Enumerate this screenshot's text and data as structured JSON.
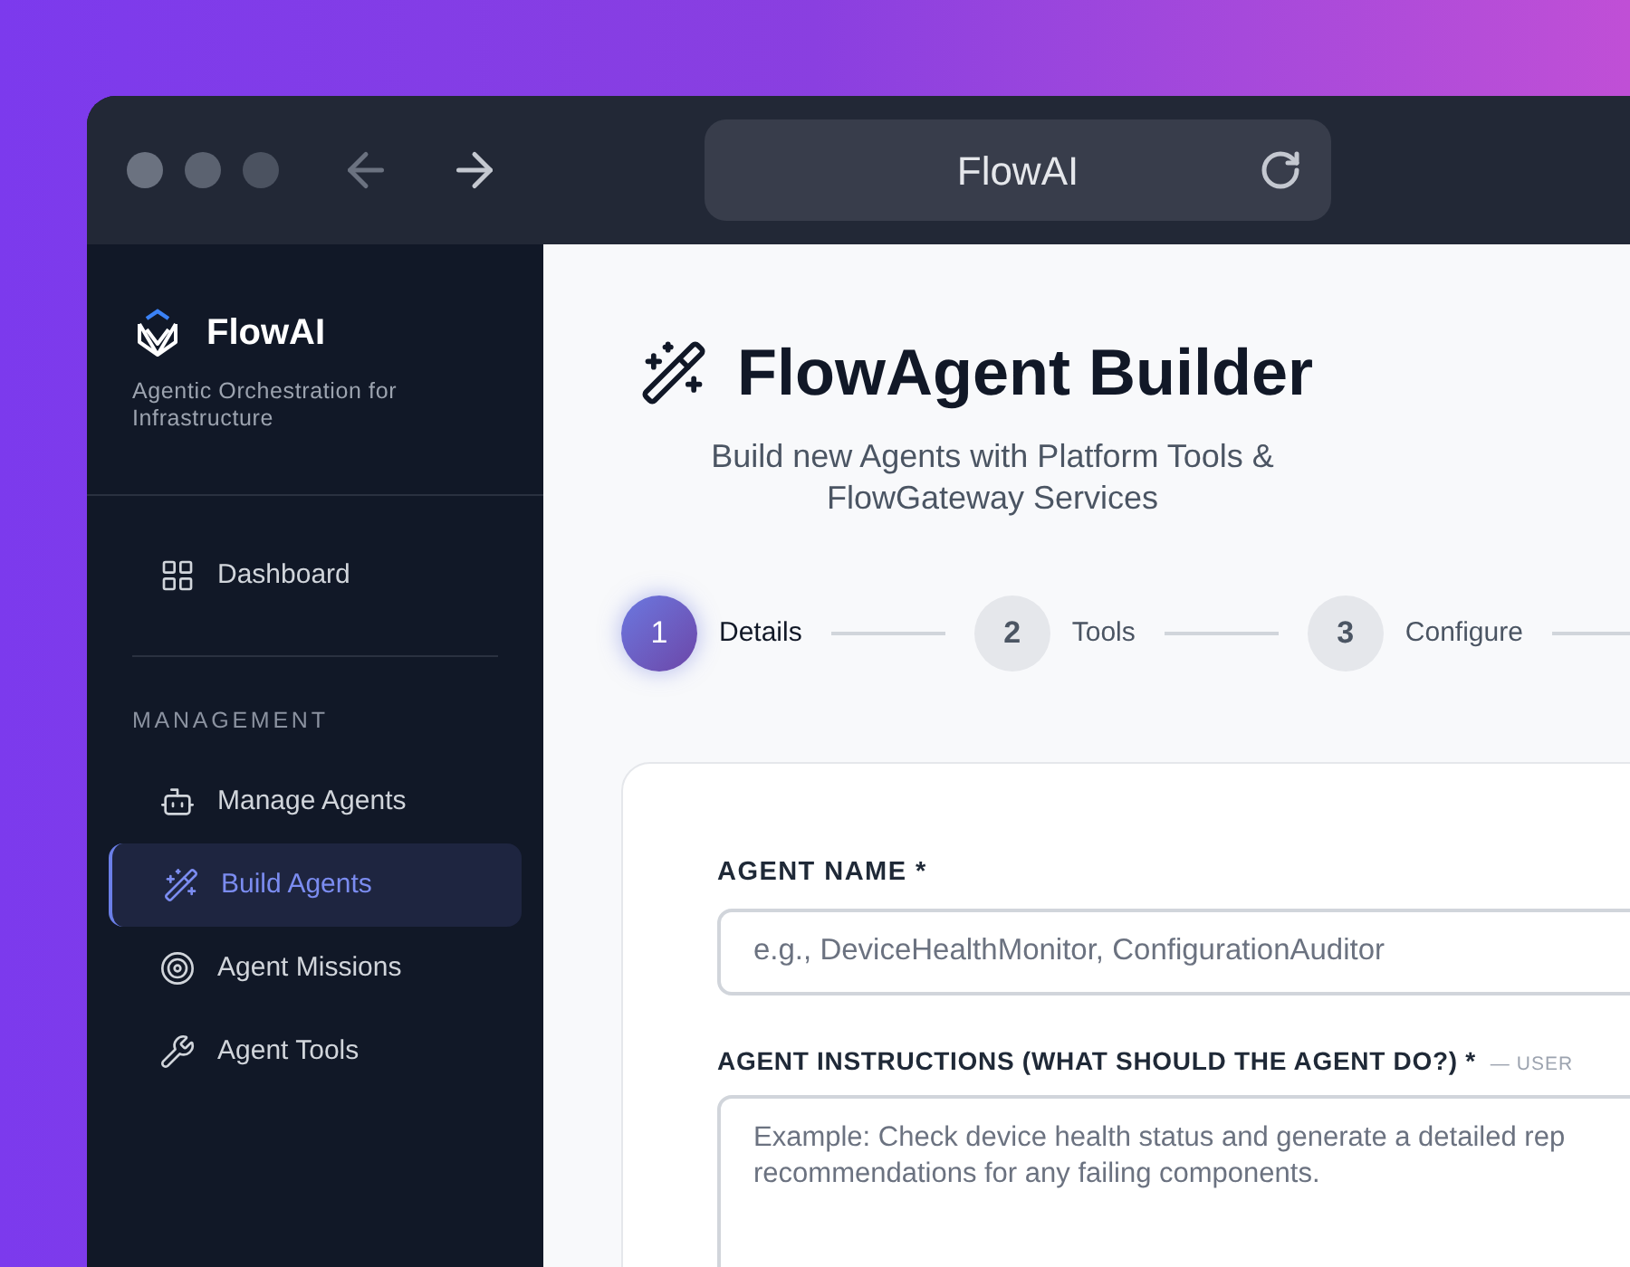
{
  "browser": {
    "title": "FlowAI"
  },
  "sidebar": {
    "brand": "FlowAI",
    "tagline": "Agentic Orchestration for Infrastructure",
    "top_items": [
      {
        "label": "Dashboard",
        "selected": false
      }
    ],
    "section": "MANAGEMENT",
    "items": [
      {
        "label": "Manage Agents",
        "selected": false
      },
      {
        "label": "Build Agents",
        "selected": true
      },
      {
        "label": "Agent Missions",
        "selected": false
      },
      {
        "label": "Agent Tools",
        "selected": false
      }
    ]
  },
  "header": {
    "title": "FlowAgent Builder",
    "subtitle": "Build new Agents with Platform Tools & FlowGateway Services"
  },
  "steps": [
    {
      "number": "1",
      "label": "Details",
      "selected": true
    },
    {
      "number": "2",
      "label": "Tools",
      "selected": false
    },
    {
      "number": "3",
      "label": "Configure",
      "selected": false
    }
  ],
  "form": {
    "name_label": "AGENT NAME *",
    "name_placeholder": "e.g., DeviceHealthMonitor, ConfigurationAuditor",
    "instructions_label": "AGENT INSTRUCTIONS (WHAT SHOULD THE AGENT DO?) *",
    "instructions_hint": "— USER",
    "instructions_placeholder": "Example: Check device health status and generate a detailed rep recommendations for any failing components."
  }
}
